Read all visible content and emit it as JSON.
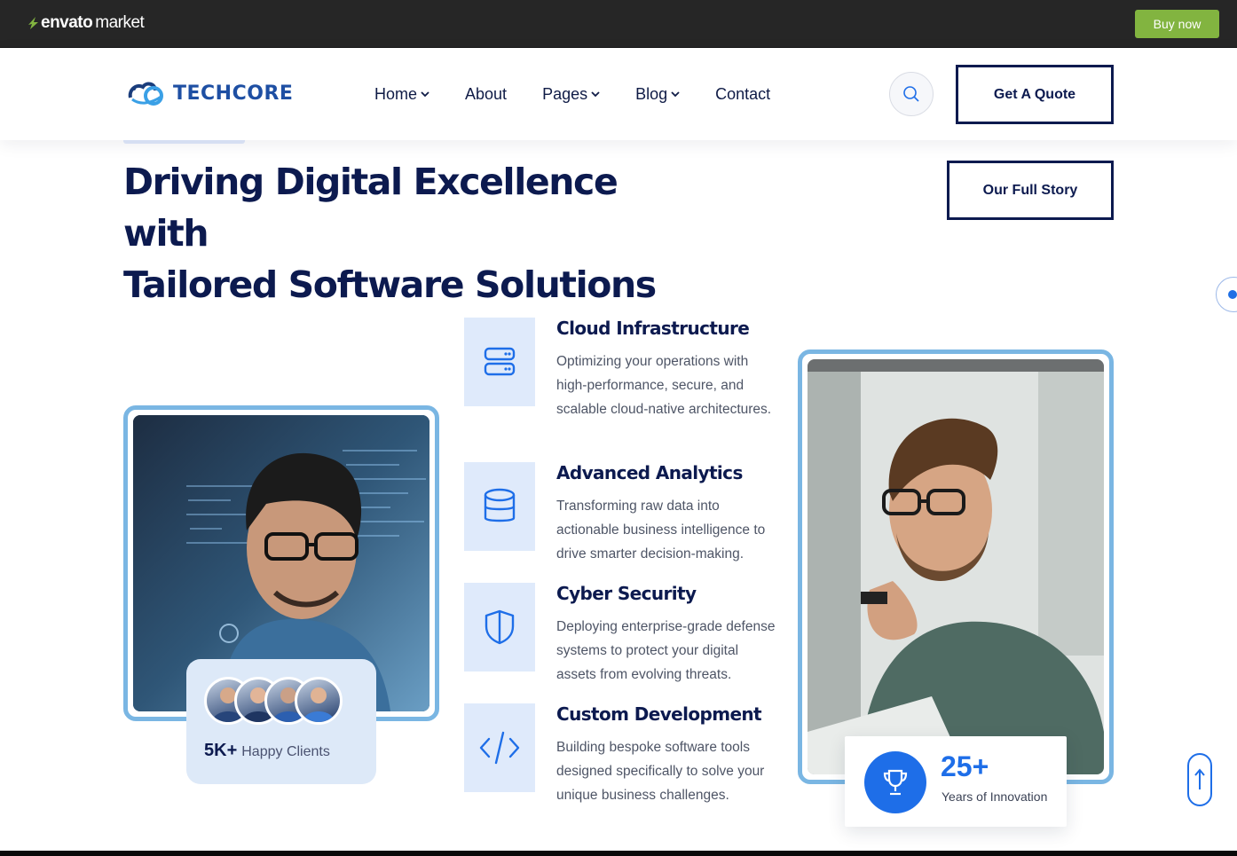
{
  "envato": {
    "logo_word": "envato",
    "logo_market": "market",
    "buy_now": "Buy now",
    "accent": "#82b440"
  },
  "header": {
    "brand": "TECHCORE",
    "nav": [
      {
        "label": "Home",
        "has_dropdown": true
      },
      {
        "label": "About",
        "has_dropdown": false
      },
      {
        "label": "Pages",
        "has_dropdown": true
      },
      {
        "label": "Blog",
        "has_dropdown": true
      },
      {
        "label": "Contact",
        "has_dropdown": false
      }
    ],
    "search_icon": "search-icon",
    "quote_button": "Get A Quote"
  },
  "hero": {
    "title_line1": "Driving Digital Excellence with",
    "title_line2": "Tailored Software Solutions",
    "story_button": "Our Full Story"
  },
  "clients": {
    "count": "5K+",
    "label": "Happy Clients"
  },
  "features": [
    {
      "icon": "server-icon",
      "title": "Cloud Infrastructure",
      "desc": "Optimizing your operations with high-performance, secure, and scalable cloud-native architectures."
    },
    {
      "icon": "database-icon",
      "title": "Advanced Analytics",
      "desc": "Transforming raw data into actionable business intelligence to drive smarter decision-making."
    },
    {
      "icon": "shield-icon",
      "title": "Cyber Security",
      "desc": "Deploying enterprise-grade defense systems to protect your digital assets from evolving threats."
    },
    {
      "icon": "code-icon",
      "title": "Custom Development",
      "desc": "Building bespoke software tools designed specifically to solve your unique business challenges."
    }
  ],
  "stat": {
    "number": "25+",
    "label": "Years of Innovation",
    "icon": "trophy-icon"
  },
  "colors": {
    "navy": "#0c1a4f",
    "primary_blue": "#1e6ee8",
    "frame_blue": "#7ab6e3",
    "icon_bg": "#dfeafb"
  }
}
